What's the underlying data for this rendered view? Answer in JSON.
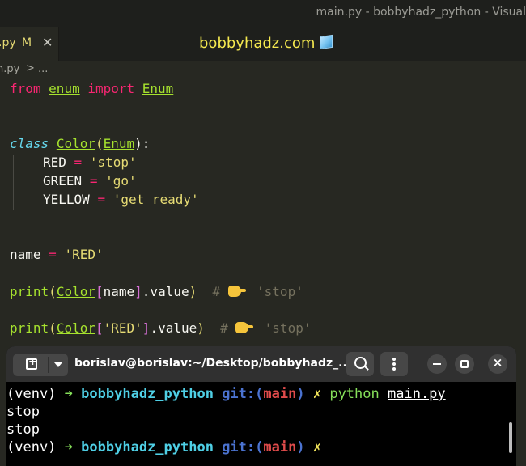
{
  "window": {
    "title": "main.py - bobbyhadz_python - Visual"
  },
  "tab": {
    "filename": ".py",
    "modified": "M",
    "close": "✕"
  },
  "banner": {
    "text": "bobbyhadz.com"
  },
  "breadcrumb": {
    "file": "n.py",
    "separator": ">",
    "more": "..."
  },
  "code": {
    "from": "from",
    "module": "enum",
    "import": "import",
    "imported": "Enum",
    "class_kw": "class",
    "class_name": "Color",
    "base": "Enum",
    "members": [
      {
        "name": "RED",
        "value": "'stop'"
      },
      {
        "name": "GREEN",
        "value": "'go'"
      },
      {
        "name": "YELLOW",
        "value": "'get ready'"
      }
    ],
    "var_name": "name",
    "var_value": "'RED'",
    "print1_index": "name",
    "print1_attr": ".value",
    "print1_comment": "# ",
    "print1_result": "'stop'",
    "print2_index": "'RED'",
    "print2_attr": ".value",
    "print2_comment": "# ",
    "print2_result": "'stop'",
    "print_fn": "print",
    "eq": "=",
    "colon": "):"
  },
  "terminal": {
    "title": "borislav@borislav:~/Desktop/bobbyhadz_...",
    "venv": "(venv)",
    "arrow": "➜",
    "project": "bobbyhadz_python",
    "git": "git:(",
    "branch": "main",
    "git_close": ")",
    "dirty": "✗",
    "command": "python",
    "argument": "main.py",
    "output": [
      "stop",
      "stop"
    ]
  }
}
